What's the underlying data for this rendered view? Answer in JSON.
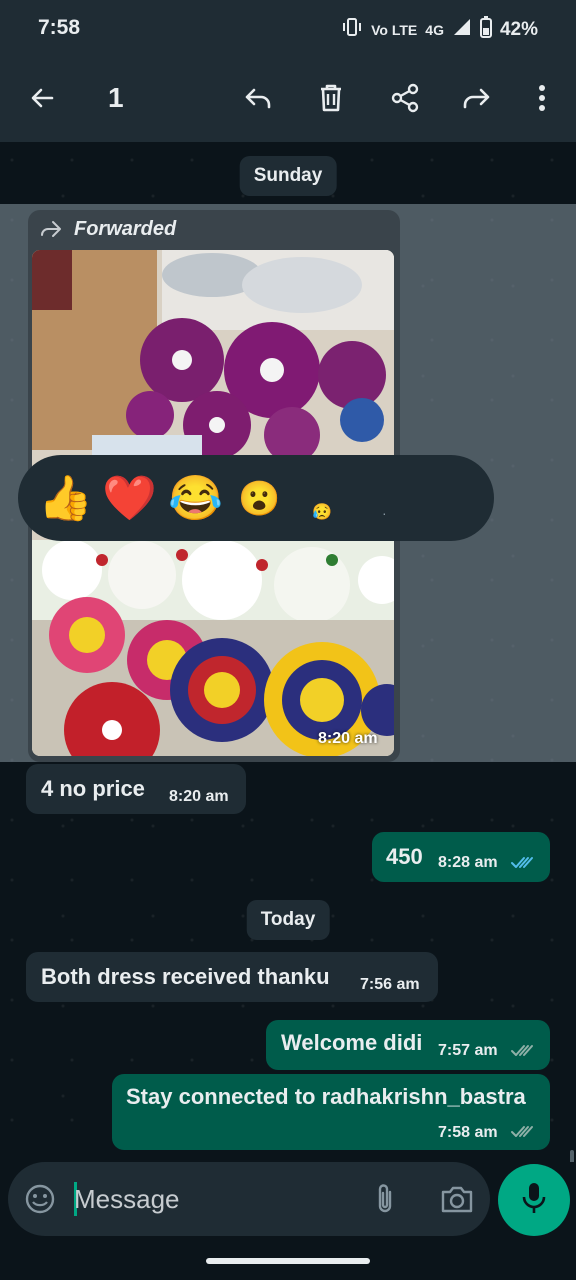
{
  "status_bar": {
    "time": "7:58",
    "network": "4G",
    "volte": "Vo LTE",
    "battery": "42%"
  },
  "app_bar": {
    "selected_count": "1",
    "icons": [
      "back-icon",
      "reply-icon",
      "delete-icon",
      "share-icon",
      "forward-icon",
      "more-icon"
    ]
  },
  "chat": {
    "date_sunday": "Sunday",
    "date_today": "Today",
    "forwarded_label": "Forwarded",
    "photo_message": {
      "time": "8:20 am"
    },
    "reactions": [
      "👍",
      "❤️",
      "😂",
      "😮",
      "😥",
      "·"
    ],
    "messages": [
      {
        "direction": "in",
        "text": "4 no price",
        "time": "8:20 am"
      },
      {
        "direction": "out",
        "text": "450",
        "time": "8:28 am",
        "status": "read"
      },
      {
        "direction": "in",
        "text": "Both dress received  thanku",
        "time": "7:56 am"
      },
      {
        "direction": "out",
        "text": "Welcome didi",
        "time": "7:57 am",
        "status": "delivered"
      },
      {
        "direction": "out",
        "text": "Stay connected to radhakrishn_bastra",
        "time": "7:58 am",
        "status": "delivered"
      }
    ]
  },
  "composer": {
    "placeholder": "Message"
  },
  "colors": {
    "header": "#1f2c34",
    "background": "#0b141a",
    "incoming_bubble": "#1f2c34",
    "outgoing_bubble": "#005c4b",
    "accent": "#00a884",
    "read_tick": "#53bdeb"
  }
}
